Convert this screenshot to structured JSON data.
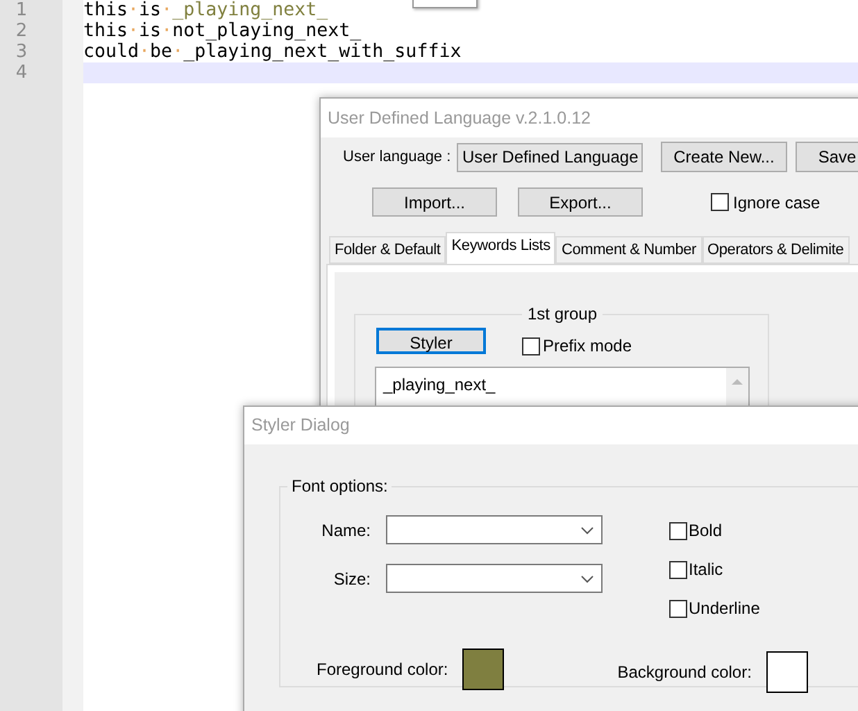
{
  "editor": {
    "lines": [
      {
        "number": "1",
        "current": false,
        "tokens": [
          {
            "kind": "word",
            "text": "this"
          },
          {
            "kind": "space",
            "text": "·"
          },
          {
            "kind": "word",
            "text": "is"
          },
          {
            "kind": "space",
            "text": "·"
          },
          {
            "kind": "keyword",
            "text": "_playing_next_"
          }
        ]
      },
      {
        "number": "2",
        "current": false,
        "tokens": [
          {
            "kind": "word",
            "text": "this"
          },
          {
            "kind": "space",
            "text": "·"
          },
          {
            "kind": "word",
            "text": "is"
          },
          {
            "kind": "space",
            "text": "·"
          },
          {
            "kind": "word",
            "text": "not_playing_next_"
          }
        ]
      },
      {
        "number": "3",
        "current": false,
        "tokens": [
          {
            "kind": "word",
            "text": "could"
          },
          {
            "kind": "space",
            "text": "·"
          },
          {
            "kind": "word",
            "text": "be"
          },
          {
            "kind": "space",
            "text": "·"
          },
          {
            "kind": "word",
            "text": "_playing_next_with_suffix"
          }
        ]
      },
      {
        "number": "4",
        "current": true
      }
    ]
  },
  "udl_window": {
    "title": "User Defined Language v.2.1.0.12",
    "user_language_label": "User language :",
    "language_select": "User Defined Language",
    "buttons": [
      "Create New...",
      "Save"
    ],
    "file_buttons": [
      "Import...",
      "Export..."
    ],
    "ignore_case": {
      "label": "Ignore case",
      "checked": false
    },
    "tabs": [
      {
        "label": "Folder & Default",
        "selected": false
      },
      {
        "label": "Keywords Lists",
        "selected": true
      },
      {
        "label": "Comment & Number",
        "selected": false
      },
      {
        "label": "Operators & Delimite",
        "selected": false
      }
    ],
    "group": {
      "title": "1st group",
      "styler_button": "Styler",
      "prefix_mode": {
        "label": "Prefix mode",
        "checked": false
      },
      "keywords": "_playing_next_"
    }
  },
  "styler_dialog": {
    "title": "Styler Dialog",
    "font_options": {
      "title": "Font options:",
      "name_label": "Name:",
      "size_label": "Size:",
      "styles": [
        {
          "label": "Bold",
          "checked": false
        },
        {
          "label": "Italic",
          "checked": false
        },
        {
          "label": "Underline",
          "checked": false
        }
      ],
      "foreground": {
        "label": "Foreground color:",
        "color": "#7f7f40"
      },
      "background": {
        "label": "Background color:",
        "color": "#ffffff"
      }
    }
  }
}
